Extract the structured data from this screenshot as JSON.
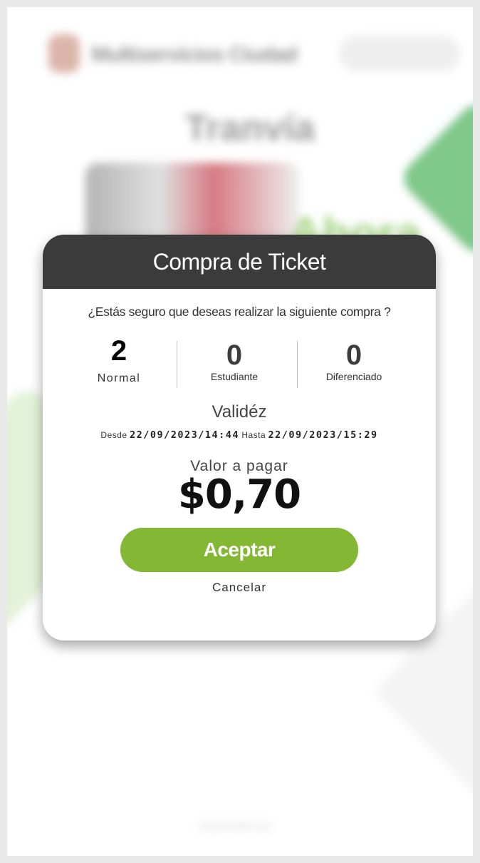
{
  "background": {
    "app_name": "Multiservicios Ciudad",
    "hero_title": "Tranvía",
    "hero_word": "Ahora",
    "footer_text": "Impulsado por",
    "accent_green": "#37a848"
  },
  "modal": {
    "title": "Compra de Ticket",
    "question": "¿Estás seguro que deseas realizar la siguiente compra ?",
    "counts": [
      {
        "value": "2",
        "label": "Normal"
      },
      {
        "value": "0",
        "label": "Estudiante"
      },
      {
        "value": "0",
        "label": "Diferenciado"
      }
    ],
    "validity": {
      "title": "Validéz",
      "from_label": "Desde",
      "from_value": "22/09/2023/14:44",
      "to_label": "Hasta",
      "to_value": "22/09/2023/15:29"
    },
    "payment": {
      "label": "Valor a pagar",
      "amount": "$0,70"
    },
    "accept_label": "Aceptar",
    "cancel_label": "Cancelar",
    "colors": {
      "header_bg": "#3b3b3b",
      "accept_bg": "#84b834"
    }
  }
}
